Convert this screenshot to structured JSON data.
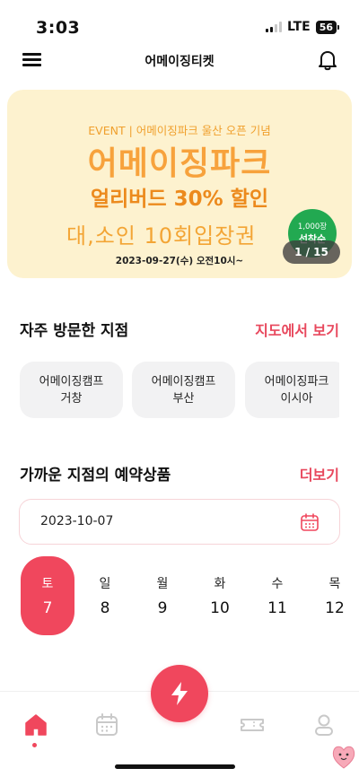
{
  "status_bar": {
    "time": "3:03",
    "network": "LTE",
    "battery": "56"
  },
  "header": {
    "title": "어메이징티켓"
  },
  "banner": {
    "event_line": "EVENT | 어메이징파크 울산 오픈 기념",
    "main_text": "어메이징파크",
    "sub_text": "얼리버드 30% 할인",
    "line3": "대,소인 10회입장권",
    "date_text": "2023-09-27(수) 오전10시~",
    "badge_top": "1,000장",
    "badge_bottom": "선착순",
    "counter": "1 / 15"
  },
  "frequent_branches": {
    "title": "자주 방문한 지점",
    "map_link": "지도에서 보기",
    "items": [
      {
        "line1": "어메이징캠프",
        "line2": "거창"
      },
      {
        "line1": "어메이징캠프",
        "line2": "부산"
      },
      {
        "line1": "어메이징파크",
        "line2": "이시아"
      }
    ]
  },
  "nearby_products": {
    "title": "가까운 지점의 예약상품",
    "more_link": "더보기",
    "date_value": "2023-10-07",
    "days": [
      {
        "dow": "토",
        "num": "7",
        "selected": true
      },
      {
        "dow": "일",
        "num": "8",
        "selected": false
      },
      {
        "dow": "월",
        "num": "9",
        "selected": false
      },
      {
        "dow": "화",
        "num": "10",
        "selected": false
      },
      {
        "dow": "수",
        "num": "11",
        "selected": false
      },
      {
        "dow": "목",
        "num": "12",
        "selected": false
      }
    ]
  },
  "bottom_nav": {
    "items": [
      {
        "name": "home",
        "icon": "home-icon",
        "active": true
      },
      {
        "name": "calendar",
        "icon": "calendar-icon",
        "active": false
      },
      {
        "name": "ticket",
        "icon": "ticket-icon",
        "active": false
      },
      {
        "name": "profile",
        "icon": "person-icon",
        "active": false
      }
    ],
    "fab_icon": "lightning-icon"
  },
  "colors": {
    "accent": "#f0475d",
    "banner_bg": "#fdf2cf",
    "chip_bg": "#f2f2f3",
    "badge_green": "#22a951"
  }
}
